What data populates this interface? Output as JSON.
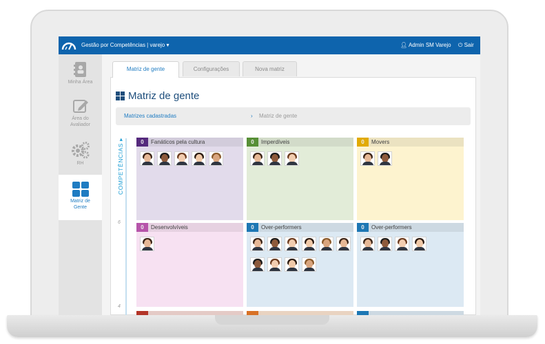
{
  "topbar": {
    "app_title": "Gestão por Competências | varejo ▾",
    "user": "Admin SM Varejo",
    "logout": "Sair"
  },
  "sidebar": {
    "items": [
      {
        "label": "Minha Área",
        "icon": "contacts-book-icon"
      },
      {
        "label": "Área do Avaliador",
        "icon": "edit-icon"
      },
      {
        "label": "RH",
        "icon": "gears-icon"
      },
      {
        "label": "Matriz de Gente",
        "icon": "grid-icon",
        "active": true
      }
    ]
  },
  "tabs": [
    {
      "label": "Matriz de gente",
      "active": true
    },
    {
      "label": "Configurações"
    },
    {
      "label": "Nova matriz"
    }
  ],
  "page_title": "Matriz de gente",
  "breadcrumb": {
    "link": "Matrizes cadastradas",
    "separator": "›",
    "current": "Matriz de gente"
  },
  "matrix": {
    "axis_label": "COMPETÊNCIAS ▸",
    "ticks": [
      "6",
      "4"
    ],
    "cells": [
      {
        "count": "0",
        "name": "Fanáticos pela cultura",
        "color": "#5b2d86",
        "bg": "#e2dbeb",
        "avatars": 5
      },
      {
        "count": "0",
        "name": "Imperdíveis",
        "color": "#5e9a3a",
        "bg": "#e2ecd8",
        "avatars": 3
      },
      {
        "count": "0",
        "name": "Movers",
        "color": "#f2b705",
        "bg": "#fdf3cf",
        "avatars": 2
      },
      {
        "count": "0",
        "name": "Desenvolvíveis",
        "color": "#c45bb7",
        "bg": "#f7e1f2",
        "avatars": 1
      },
      {
        "count": "0",
        "name": "Over-performers",
        "color": "#1f80c2",
        "bg": "#dce9f3",
        "avatars": 10
      },
      {
        "count": "0",
        "name": "Over-performers",
        "color": "#1f80c2",
        "bg": "#dce9f3",
        "avatars": 4
      },
      {
        "count": "",
        "name": "",
        "color": "#c0392b",
        "bg": "#f5d9d5",
        "avatars": 0
      },
      {
        "count": "",
        "name": "",
        "color": "#e87b2a",
        "bg": "#fbe3cf",
        "avatars": 0
      },
      {
        "count": "",
        "name": "",
        "color": "#1f80c2",
        "bg": "#dce9f3",
        "avatars": 0
      }
    ]
  }
}
